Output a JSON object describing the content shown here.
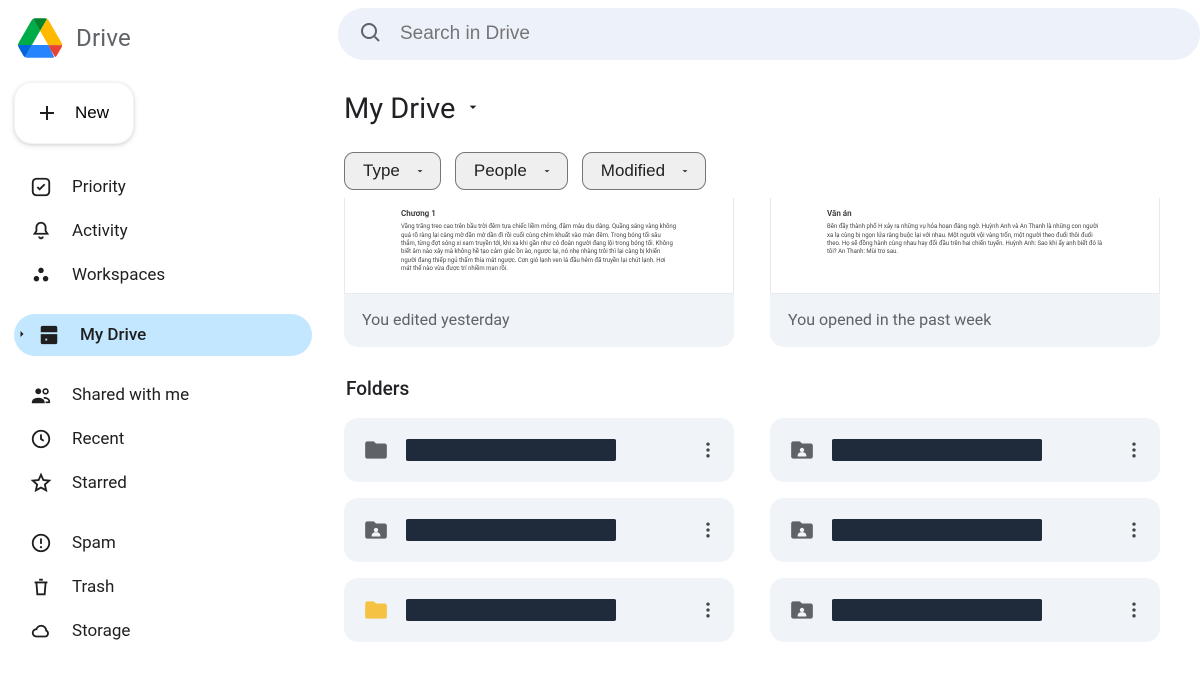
{
  "brand": {
    "name": "Drive"
  },
  "newButton": {
    "label": "New"
  },
  "sidebar": {
    "priority": "Priority",
    "activity": "Activity",
    "workspaces": "Workspaces",
    "myDrive": "My Drive",
    "shared": "Shared with me",
    "recent": "Recent",
    "starred": "Starred",
    "spam": "Spam",
    "trash": "Trash",
    "storage": "Storage"
  },
  "search": {
    "placeholder": "Search in Drive"
  },
  "page": {
    "title": "My Drive"
  },
  "filters": {
    "type": "Type",
    "people": "People",
    "modified": "Modified"
  },
  "suggested": {
    "cards": [
      {
        "previewTitle": "Chương 1",
        "previewBody": "Vầng trăng treo cao trên bầu trời đêm tựa chiếc liềm mỏng, đậm màu dịu dàng. Quầng sáng vàng không quá rõ ràng lại càng mờ dần mờ dần đi rồi cuối cùng chìm khuất vào màn đêm.\nTrong bóng tối sâu thẳm, từng đợt sóng xi xam truyền tới, khi xa khi gần như có đoàn người đang lội trong bóng tối. Không biết âm nào xây mà không hề tạo cảm giác ồn ào, ngược lại, nó nhẹ nhàng trôi thì lại càng bị khiến người đang thiếp ngủ thấm thía mắt ngược.\nCơn gió lạnh ven lá đầu hẻm đã truyền lại chút lạnh. Hơi mát thế nào vừa được trí nhiềm man rồi.",
        "status": "You edited yesterday"
      },
      {
        "previewTitle": "Văn án",
        "previewBody": "Bên đầy thành phố H xảy ra những vụ hỏa hoạn đáng ngờ.\nHuỳnh Anh và An Thanh là những con người xa lạ cùng bị ngọn lửa ràng buộc lại với nhau.\nMột người vội vàng trốn, một người theo đuổi thôi đuổi theo. Họ sẽ đồng hành cùng nhau hay đối đầu trên hai chiến tuyến.\nHuỳnh Anh: Sao khi ấy anh biết đó là tôi?\nAn Thanh: Mùi tro sau.",
        "status": "You opened in the past week"
      }
    ]
  },
  "foldersSection": {
    "title": "Folders"
  },
  "folders": [
    {
      "iconType": "folder",
      "color": "#5f6368",
      "redacted": true
    },
    {
      "iconType": "folder-shared",
      "color": "#5f6368",
      "redacted": true
    },
    {
      "iconType": "folder-shared",
      "color": "#5f6368",
      "redacted": true
    },
    {
      "iconType": "folder-shared",
      "color": "#5f6368",
      "redacted": true
    },
    {
      "iconType": "folder",
      "color": "#f6c244",
      "redacted": true
    },
    {
      "iconType": "folder-shared",
      "color": "#5f6368",
      "redacted": true
    }
  ]
}
